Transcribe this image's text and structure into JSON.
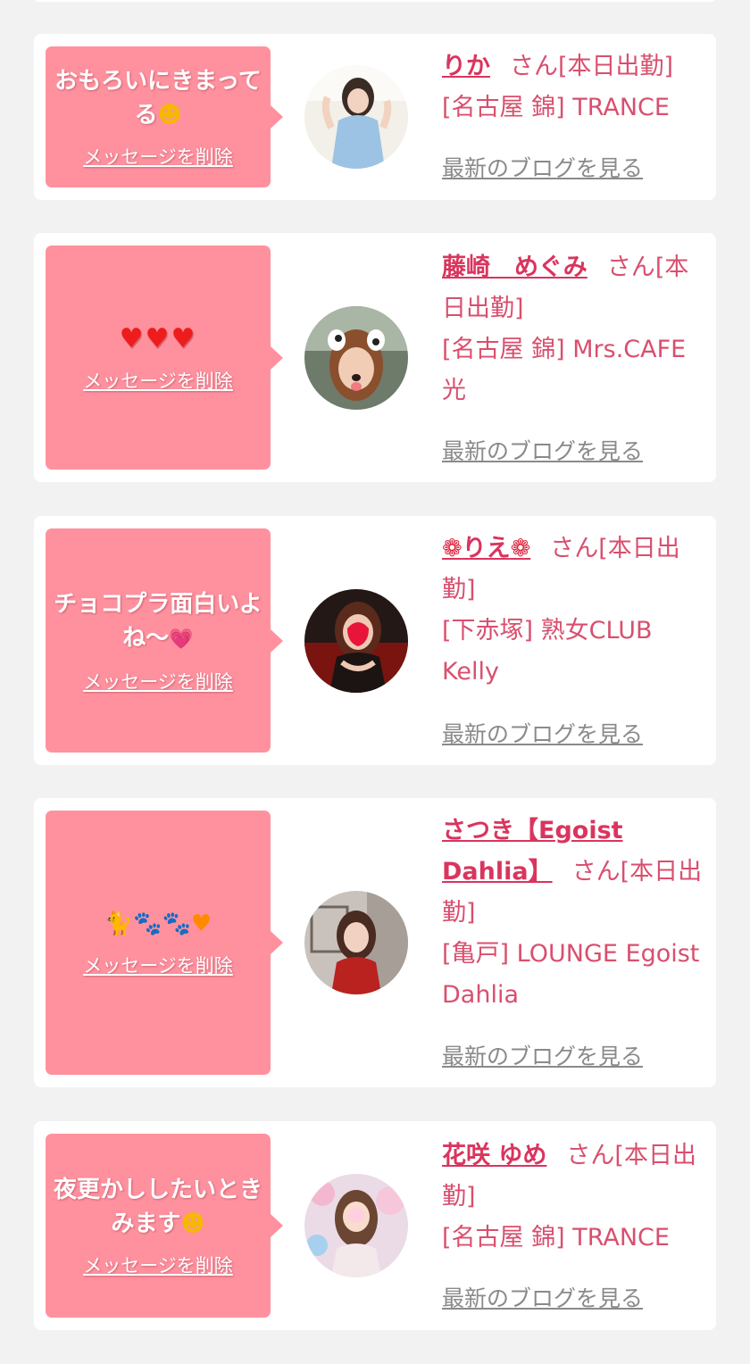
{
  "delete_label": "メッセージを削除",
  "blog_label": "最新のブログを見る",
  "san_label": "さん",
  "cards": [
    {
      "message": "おもろいにきまってる",
      "emoji": "rolling-laugh-emoji",
      "name": "りか",
      "status": "[本日出勤]",
      "shop": "[名古屋 錦] TRANCE"
    },
    {
      "message": "♥♥♥",
      "name": "藤崎　めぐみ",
      "status": "[本日出勤]",
      "shop": "[名古屋 錦] Mrs.CAFE光"
    },
    {
      "message": "チョコプラ面白いよね〜",
      "emoji": "pink-heart-emoji",
      "name": "りえ",
      "name_decoration": "rose-emoji",
      "status": "[本日出勤]",
      "shop": "[下赤塚] 熟女CLUB Kelly"
    },
    {
      "message": "",
      "emoji": "black-cat-paws-orange-heart-emoji",
      "name": "さつき【Egoist Dahlia】",
      "status": "[本日出勤]",
      "shop": "[亀戸] LOUNGE Egoist Dahlia"
    },
    {
      "message": "夜更かししたいときみます",
      "emoji": "rolling-laugh-emoji",
      "name": "花咲 ゆめ",
      "status": "[本日出勤]",
      "shop": "[名古屋 錦] TRANCE"
    }
  ],
  "colors": {
    "bubble": "#ff919e",
    "accent": "#d94f6e",
    "page_bg": "#f2f2f2"
  }
}
